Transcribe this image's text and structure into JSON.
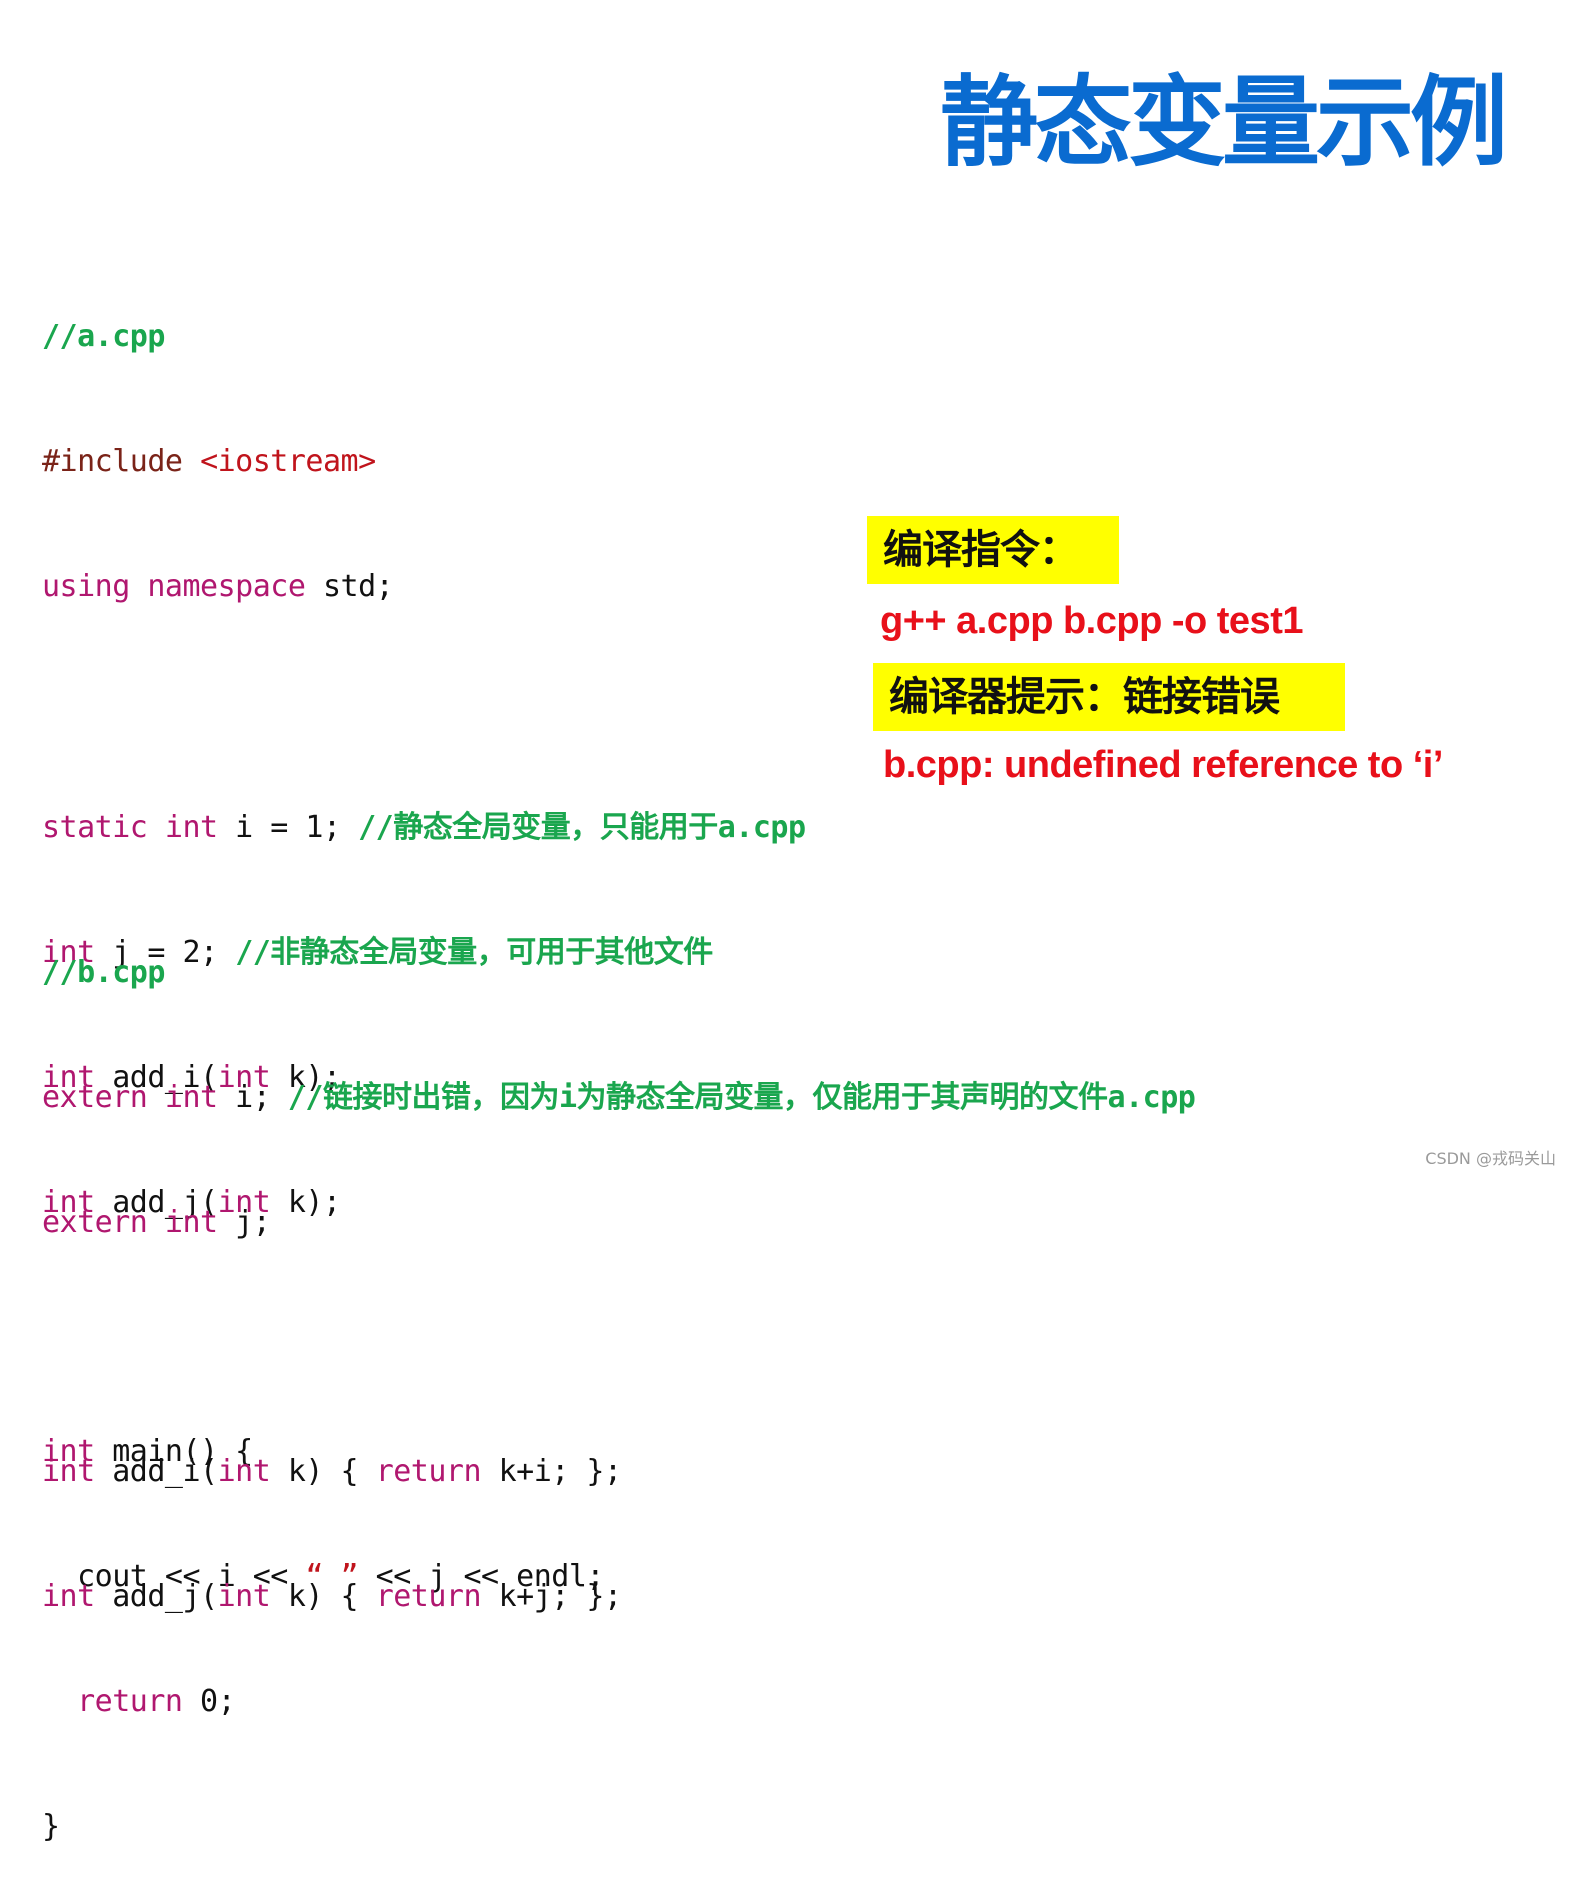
{
  "title": "静态变量示例",
  "file_a": {
    "header_comment": "//a.cpp",
    "include_directive": "#include",
    "include_target": "<iostream>",
    "using_kw": "using namespace",
    "using_rest": " std;",
    "line_static": {
      "kw": "static int",
      "code": " i = 1; ",
      "comment": "//静态全局变量，只能用于a.cpp"
    },
    "line_j": {
      "kw": "int",
      "code": " j = 2; ",
      "comment": "//非静态全局变量，可用于其他文件"
    },
    "decl_add_i": {
      "kw1": "int",
      "mid": " add_i(",
      "kw2": "int",
      "end": " k);"
    },
    "decl_add_j": {
      "kw1": "int",
      "mid": " add_j(",
      "kw2": "int",
      "end": " k);"
    },
    "main_sig": {
      "kw": "int",
      "rest": " main() {"
    },
    "cout_line": {
      "pre": "  cout << i << ",
      "str": "“ ”",
      "post": " << j << endl;"
    },
    "return_line": {
      "pre": "  ",
      "kw": "return",
      "post": " 0;"
    },
    "close_brace": "}"
  },
  "file_b": {
    "header_comment": "//b.cpp",
    "extern_i": {
      "kw": "extern int",
      "code": " i; ",
      "comment": "//链接时出错，因为i为静态全局变量，仅能用于其声明的文件a.cpp"
    },
    "extern_j": {
      "kw": "extern int",
      "code": " j;"
    },
    "def_add_i": {
      "kw1": "int",
      "mid": " add_i(",
      "kw2": "int",
      "mid2": " k) { ",
      "kw3": "return",
      "end": " k+i; };"
    },
    "def_add_j": {
      "kw1": "int",
      "mid": " add_j(",
      "kw2": "int",
      "mid2": " k) { ",
      "kw3": "return",
      "end": " k+j; };"
    }
  },
  "side_panel": {
    "compile_label": "编译指令：",
    "compile_command": "g++ a.cpp b.cpp -o test1",
    "compiler_hint_label": "编译器提示：链接错误",
    "error_message": "b.cpp: undefined reference to ‘i’"
  },
  "colors": {
    "title": "#0a6bd0",
    "comment": "#1aa64e",
    "keyword": "#b0176f",
    "preprocessor": "#7a2318",
    "string": "#c0141c",
    "highlight": "#ffff00",
    "error": "#e8101a"
  },
  "watermark": "CSDN @戎码关山"
}
